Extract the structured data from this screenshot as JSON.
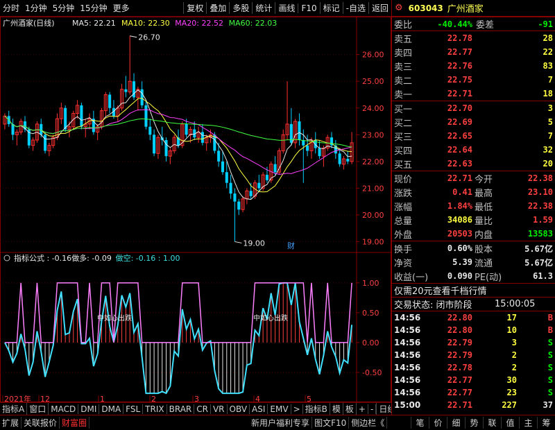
{
  "toolbar": {
    "left_items": [
      "分时",
      "1分钟",
      "5分钟",
      "15分钟",
      "更多"
    ],
    "right_items": [
      "复权",
      "叠加",
      "多股",
      "统计",
      "画线",
      "F10",
      "标记",
      "-自选",
      "返回"
    ]
  },
  "chart_data": [
    {
      "type": "candlestick",
      "title": "广州酒家(日线)",
      "ma_labels": [
        {
          "text": "MA5: 22.21",
          "color": "#e8e8e8"
        },
        {
          "text": "MA10: 22.30",
          "color": "#ffff40"
        },
        {
          "text": "MA20: 22.52",
          "color": "#ff40ff"
        },
        {
          "text": "MA60: 22.03",
          "color": "#40ff40"
        }
      ],
      "ylim": [
        18.7,
        26.9
      ],
      "yticks": [
        19.0,
        20.0,
        21.0,
        22.0,
        23.0,
        24.0,
        25.0,
        26.0
      ],
      "xticks": [
        "2021年",
        "12",
        "1",
        "2",
        "3",
        "4",
        "5"
      ],
      "annotations": {
        "high": "26.70",
        "low": "19.00",
        "caitag": "财"
      },
      "candles": [
        [
          23.4,
          23.8,
          23.2,
          23.7
        ],
        [
          23.7,
          23.9,
          23.3,
          23.4
        ],
        [
          23.4,
          23.6,
          22.8,
          23.0
        ],
        [
          23.0,
          23.2,
          22.6,
          23.1
        ],
        [
          23.1,
          23.6,
          23.0,
          23.5
        ],
        [
          23.5,
          23.7,
          23.1,
          23.2
        ],
        [
          23.2,
          23.3,
          22.5,
          22.6
        ],
        [
          22.6,
          22.9,
          22.4,
          22.8
        ],
        [
          22.8,
          23.5,
          22.7,
          23.4
        ],
        [
          23.4,
          23.6,
          22.9,
          23.0
        ],
        [
          23.0,
          23.1,
          22.3,
          22.4
        ],
        [
          22.4,
          22.7,
          22.2,
          22.6
        ],
        [
          22.6,
          23.0,
          22.5,
          22.9
        ],
        [
          22.9,
          23.8,
          22.8,
          23.6
        ],
        [
          23.6,
          24.2,
          23.4,
          24.0
        ],
        [
          24.0,
          24.1,
          23.1,
          23.2
        ],
        [
          23.2,
          23.5,
          22.9,
          23.3
        ],
        [
          23.3,
          23.9,
          23.2,
          23.8
        ],
        [
          23.8,
          24.3,
          23.6,
          24.1
        ],
        [
          24.1,
          24.2,
          23.2,
          23.3
        ],
        [
          23.3,
          23.6,
          22.9,
          23.4
        ],
        [
          23.4,
          23.8,
          23.2,
          23.6
        ],
        [
          23.6,
          23.9,
          23.0,
          23.1
        ],
        [
          23.1,
          23.4,
          22.8,
          23.3
        ],
        [
          23.3,
          24.0,
          23.2,
          23.9
        ],
        [
          23.9,
          24.6,
          23.7,
          24.5
        ],
        [
          24.5,
          24.6,
          23.8,
          24.0
        ],
        [
          24.0,
          24.3,
          23.6,
          23.7
        ],
        [
          23.7,
          24.1,
          23.5,
          24.0
        ],
        [
          24.0,
          24.9,
          23.9,
          24.7
        ],
        [
          24.7,
          25.2,
          24.4,
          24.6
        ],
        [
          24.6,
          26.7,
          24.5,
          25.0
        ],
        [
          25.0,
          25.3,
          24.3,
          24.4
        ],
        [
          24.4,
          24.8,
          23.9,
          24.7
        ],
        [
          24.7,
          25.0,
          24.0,
          24.1
        ],
        [
          24.1,
          24.3,
          23.2,
          23.3
        ],
        [
          23.3,
          23.6,
          22.8,
          23.0
        ],
        [
          23.0,
          23.2,
          22.2,
          22.3
        ],
        [
          22.3,
          23.0,
          22.1,
          22.9
        ],
        [
          22.9,
          23.3,
          22.6,
          22.8
        ],
        [
          22.8,
          22.9,
          22.0,
          22.2
        ],
        [
          22.2,
          22.5,
          21.9,
          22.4
        ],
        [
          22.4,
          23.0,
          22.3,
          22.9
        ],
        [
          22.9,
          23.2,
          22.5,
          22.6
        ],
        [
          22.6,
          23.5,
          22.5,
          23.4
        ],
        [
          23.4,
          23.6,
          22.9,
          23.0
        ],
        [
          23.0,
          23.3,
          22.7,
          23.2
        ],
        [
          23.2,
          23.5,
          22.8,
          22.9
        ],
        [
          22.9,
          23.3,
          22.7,
          23.1
        ],
        [
          23.1,
          23.4,
          22.6,
          22.7
        ],
        [
          22.7,
          23.0,
          22.4,
          22.9
        ],
        [
          22.9,
          23.2,
          22.7,
          23.0
        ],
        [
          23.0,
          23.1,
          22.3,
          22.4
        ],
        [
          22.4,
          22.7,
          21.8,
          22.0
        ],
        [
          22.0,
          22.4,
          21.5,
          21.6
        ],
        [
          21.6,
          22.0,
          21.0,
          21.2
        ],
        [
          21.2,
          21.5,
          20.6,
          20.8
        ],
        [
          20.8,
          21.0,
          19.0,
          20.5
        ],
        [
          20.5,
          20.6,
          20.0,
          20.2
        ],
        [
          20.2,
          20.7,
          20.1,
          20.6
        ],
        [
          20.6,
          21.0,
          20.4,
          20.9
        ],
        [
          20.9,
          21.2,
          20.6,
          20.7
        ],
        [
          20.7,
          21.3,
          20.6,
          21.2
        ],
        [
          21.2,
          21.5,
          20.9,
          21.0
        ],
        [
          21.0,
          21.6,
          20.9,
          21.5
        ],
        [
          21.5,
          21.8,
          21.2,
          21.3
        ],
        [
          21.3,
          22.0,
          21.2,
          21.9
        ],
        [
          21.9,
          22.2,
          21.5,
          21.6
        ],
        [
          21.6,
          22.5,
          21.5,
          22.4
        ],
        [
          22.4,
          23.2,
          22.3,
          23.0
        ],
        [
          23.0,
          25.0,
          22.8,
          23.4
        ],
        [
          23.4,
          24.0,
          22.6,
          22.7
        ],
        [
          22.7,
          23.6,
          22.5,
          23.5
        ],
        [
          23.5,
          23.8,
          22.6,
          22.8
        ],
        [
          22.8,
          23.2,
          21.2,
          22.6
        ],
        [
          22.6,
          23.0,
          22.2,
          22.4
        ],
        [
          22.4,
          22.9,
          22.1,
          22.8
        ],
        [
          22.8,
          23.1,
          22.3,
          22.5
        ],
        [
          22.5,
          22.8,
          22.1,
          22.2
        ],
        [
          22.2,
          22.6,
          21.8,
          22.5
        ],
        [
          22.5,
          23.0,
          22.4,
          22.9
        ],
        [
          22.9,
          23.1,
          22.5,
          22.6
        ],
        [
          22.6,
          22.8,
          22.1,
          22.3
        ],
        [
          22.3,
          22.5,
          21.8,
          21.9
        ],
        [
          21.9,
          22.2,
          21.7,
          22.1
        ],
        [
          22.1,
          22.4,
          21.9,
          22.0
        ],
        [
          22.0,
          23.1,
          21.9,
          22.7
        ]
      ]
    },
    {
      "type": "indicator",
      "title": "指标公式",
      "labels": [
        {
          "text": "指标公式 : -0.16",
          "color": "#e8e8e8"
        },
        {
          "text": "做多: -0.09",
          "color": "#e8e8e8"
        },
        {
          "text": "做空: -0.16 : 1.00",
          "color": "#40e0e0"
        }
      ],
      "ylim": [
        -1.0,
        1.3
      ],
      "yticks": [
        1.0,
        0.5,
        0.0,
        -0.5
      ],
      "mid_text": "中如心出跌"
    }
  ],
  "quote": {
    "code": "603043",
    "name": "广州酒家",
    "weibi_label": "委比",
    "weibi": "-40.44%",
    "weicha_label": "委差",
    "weicha": "-91",
    "asks": [
      {
        "label": "卖五",
        "price": "22.78",
        "vol": "28"
      },
      {
        "label": "卖四",
        "price": "22.77",
        "vol": "22"
      },
      {
        "label": "卖三",
        "price": "22.76",
        "vol": "83"
      },
      {
        "label": "卖二",
        "price": "22.75",
        "vol": "7"
      },
      {
        "label": "卖一",
        "price": "22.71",
        "vol": "18"
      }
    ],
    "bids": [
      {
        "label": "买一",
        "price": "22.70",
        "vol": "3"
      },
      {
        "label": "买二",
        "price": "22.69",
        "vol": "5"
      },
      {
        "label": "买三",
        "price": "22.65",
        "vol": "7"
      },
      {
        "label": "买四",
        "price": "22.64",
        "vol": "32"
      },
      {
        "label": "买五",
        "price": "22.63",
        "vol": "20"
      }
    ],
    "stats": [
      {
        "l1": "现价",
        "v1": "22.71",
        "c1": "red",
        "l2": "今开",
        "v2": "22.38",
        "c2": "red"
      },
      {
        "l1": "涨跌",
        "v1": "0.41",
        "c1": "red",
        "l2": "最高",
        "v2": "23.10",
        "c2": "red"
      },
      {
        "l1": "涨幅",
        "v1": "1.84%",
        "c1": "red",
        "l2": "最低",
        "v2": "22.38",
        "c2": "red"
      },
      {
        "l1": "总量",
        "v1": "34086",
        "c1": "yel",
        "l2": "量比",
        "v2": "1.59",
        "c2": "red"
      },
      {
        "l1": "外盘",
        "v1": "20503",
        "c1": "red",
        "l2": "内盘",
        "v2": "13583",
        "c2": "grn"
      }
    ],
    "stats2": [
      {
        "l1": "换手",
        "v1": "0.60%",
        "l2": "股本",
        "v2": "5.67亿"
      },
      {
        "l1": "净资",
        "v1": "5.39",
        "l2": "流通",
        "v2": "5.67亿"
      },
      {
        "l1": "收益(一)",
        "v1": "0.090",
        "l2": "PE(动)",
        "v2": "61.3"
      }
    ],
    "promo": "仅需20元查看千档行情",
    "status_label": "交易状态: 闭市阶段",
    "status_time": "15:00:05",
    "ticks": [
      {
        "t": "14:56",
        "p": "22.80",
        "v": "17",
        "d": "B"
      },
      {
        "t": "14:56",
        "p": "22.80",
        "v": "10",
        "d": "B"
      },
      {
        "t": "14:56",
        "p": "22.79",
        "v": "3",
        "d": "S"
      },
      {
        "t": "14:56",
        "p": "22.79",
        "v": "2",
        "d": "S"
      },
      {
        "t": "14:56",
        "p": "22.78",
        "v": "2",
        "d": "S"
      },
      {
        "t": "14:56",
        "p": "22.77",
        "v": "30",
        "d": "S"
      },
      {
        "t": "14:56",
        "p": "22.77",
        "v": "23",
        "d": "S"
      },
      {
        "t": "15:00",
        "p": "22.71",
        "v": "227",
        "d": "37"
      }
    ]
  },
  "indicator_tabs": [
    "指标A",
    "窗口",
    "MACD",
    "DMI",
    "DMA",
    "FSL",
    "TRIX",
    "BRAR",
    "CR",
    "VR",
    "OBV",
    "ASI",
    "EMV",
    ">",
    "指标B",
    "模",
    "板",
    "+",
    "-"
  ],
  "daily_label": "日线",
  "bottom_tabs": [
    "扩展",
    "关联报价",
    "财富圈",
    "新用户福利专享",
    "图文F10",
    "侧边栏《"
  ],
  "bottom_right": [
    "笔",
    "价",
    "细",
    "势",
    "联",
    "值",
    "主",
    "筹"
  ]
}
